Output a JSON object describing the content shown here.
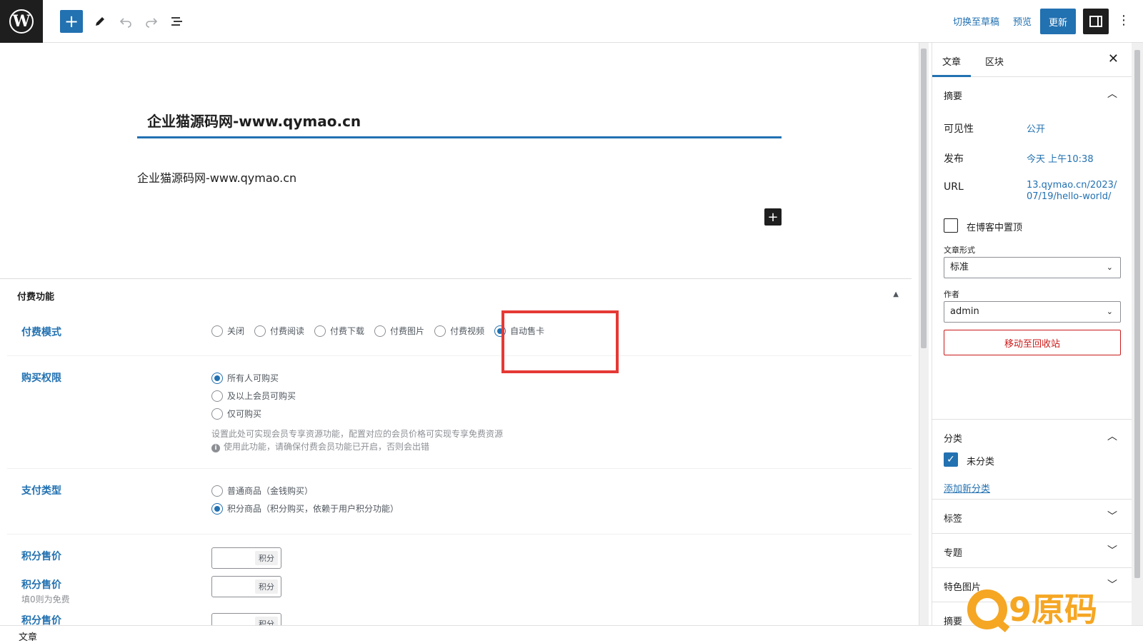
{
  "toolbar": {
    "switch_draft": "切换至草稿",
    "preview": "预览",
    "update": "更新",
    "more": "⋮"
  },
  "editor": {
    "title": "企业猫源码网-www.qymao.cn",
    "paragraph": "企业猫源码网-www.qymao.cn"
  },
  "metabox": {
    "title": "付费功能",
    "pay_mode": {
      "label": "付费模式",
      "options": [
        "关闭",
        "付费阅读",
        "付费下载",
        "付费图片",
        "付费视频",
        "自动售卡"
      ],
      "selected_index": 5
    },
    "purchase_permission": {
      "label": "购买权限",
      "options": [
        "所有人可购买",
        "及以上会员可购买",
        "仅可购买"
      ],
      "selected_index": 0,
      "help1": "设置此处可实现会员专享资源功能，配置对应的会员价格可实现专享免费资源",
      "help2": "使用此功能，请确保付费会员功能已开启，否则会出错"
    },
    "pay_type": {
      "label": "支付类型",
      "options": [
        "普通商品（金钱购买）",
        "积分商品（积分购买，依赖于用户积分功能）"
      ],
      "selected_index": 1
    },
    "points_price_1": {
      "label": "积分售价",
      "unit": "积分"
    },
    "points_price_2": {
      "label": "积分售价",
      "sub": "填0则为免费",
      "unit": "积分"
    },
    "points_price_3": {
      "label": "积分售价",
      "unit": "积分"
    }
  },
  "sidebar": {
    "tab_post": "文章",
    "tab_block": "区块",
    "summary": {
      "title": "摘要",
      "visibility_label": "可见性",
      "visibility_value": "公开",
      "publish_label": "发布",
      "publish_value": "今天 上午10:38",
      "url_label": "URL",
      "url_value_1": "13.qymao.cn/2023/",
      "url_value_2": "07/19/hello-world/",
      "sticky_label": "在博客中置顶",
      "format_label": "文章形式",
      "format_value": "标准",
      "author_label": "作者",
      "author_value": "admin",
      "trash": "移动至回收站"
    },
    "categories": {
      "title": "分类",
      "item": "未分类",
      "add_new": "添加新分类"
    },
    "tags": "标签",
    "topics": "专题",
    "featured_image": "特色图片",
    "excerpt": "摘要"
  },
  "footer": {
    "breadcrumb": "文章"
  },
  "watermark": {
    "text": "9原码"
  },
  "colors": {
    "accent": "#2271b1",
    "danger": "#cc1818",
    "highlight": "#e53935",
    "watermark": "#f5a623"
  }
}
